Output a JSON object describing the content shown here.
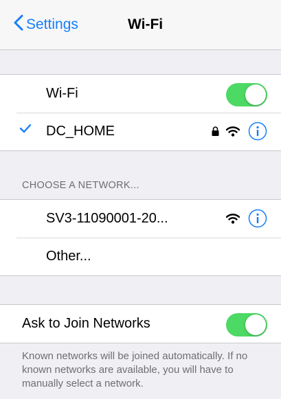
{
  "navbar": {
    "back_label": "Settings",
    "title": "Wi-Fi"
  },
  "wifi_group": {
    "wifi_label": "Wi-Fi",
    "wifi_enabled": true,
    "connected_network": "DC_HOME"
  },
  "choose_network": {
    "header": "CHOOSE A NETWORK...",
    "networks": [
      {
        "name": "SV3-11090001-20..."
      }
    ],
    "other_label": "Other..."
  },
  "ask_to_join": {
    "label": "Ask to Join Networks",
    "enabled": true,
    "footer": "Known networks will be joined automatically. If no known networks are available, you will have to manually select a network."
  },
  "colors": {
    "accent": "#147efb",
    "switch_on": "#4cd964",
    "background": "#efeff4",
    "secondary_text": "#6d6d72"
  },
  "icons": [
    "chevron-left-icon",
    "checkmark-icon",
    "lock-icon",
    "wifi-signal-icon",
    "info-icon"
  ]
}
